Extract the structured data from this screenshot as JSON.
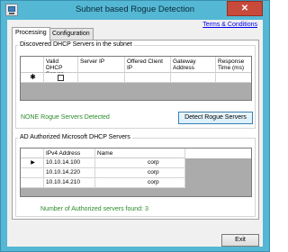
{
  "window": {
    "title": "Subnet based Rogue Detection",
    "close_glyph": "✕",
    "app_icon": "monitor-icon"
  },
  "links": {
    "terms": "Terms & Conditions"
  },
  "tabs": [
    {
      "label": "Processing",
      "active": true
    },
    {
      "label": "Configuration",
      "active": false
    }
  ],
  "discovered": {
    "title": "Discovered DHCP Servers in the subnet",
    "columns": [
      "Valid DHCP Server",
      "Server IP",
      "Offered Client IP",
      "Gateway Address",
      "Response Time (ms)"
    ],
    "new_row_marker": "✱",
    "status": "NONE Rogue Servers Detected",
    "detect_button": "Detect Rogue Servers"
  },
  "authorized": {
    "title": "AD Authorized Microsoft DHCP Servers",
    "columns": [
      "IPv4 Address",
      "Name"
    ],
    "current_row_marker": "▶",
    "rows": [
      {
        "ip": "10.10.14.100",
        "name": "corp"
      },
      {
        "ip": "10.10.14.220",
        "name": "corp"
      },
      {
        "ip": "10.10.14.210",
        "name": "corp"
      }
    ],
    "count_text": "Number of Authorized servers found: 3"
  },
  "footer": {
    "exit_button": "Exit"
  },
  "colors": {
    "titlebar": "#54b7d3",
    "close": "#c74a3a",
    "status_green": "#2a8a2a",
    "link": "#0000ee"
  }
}
